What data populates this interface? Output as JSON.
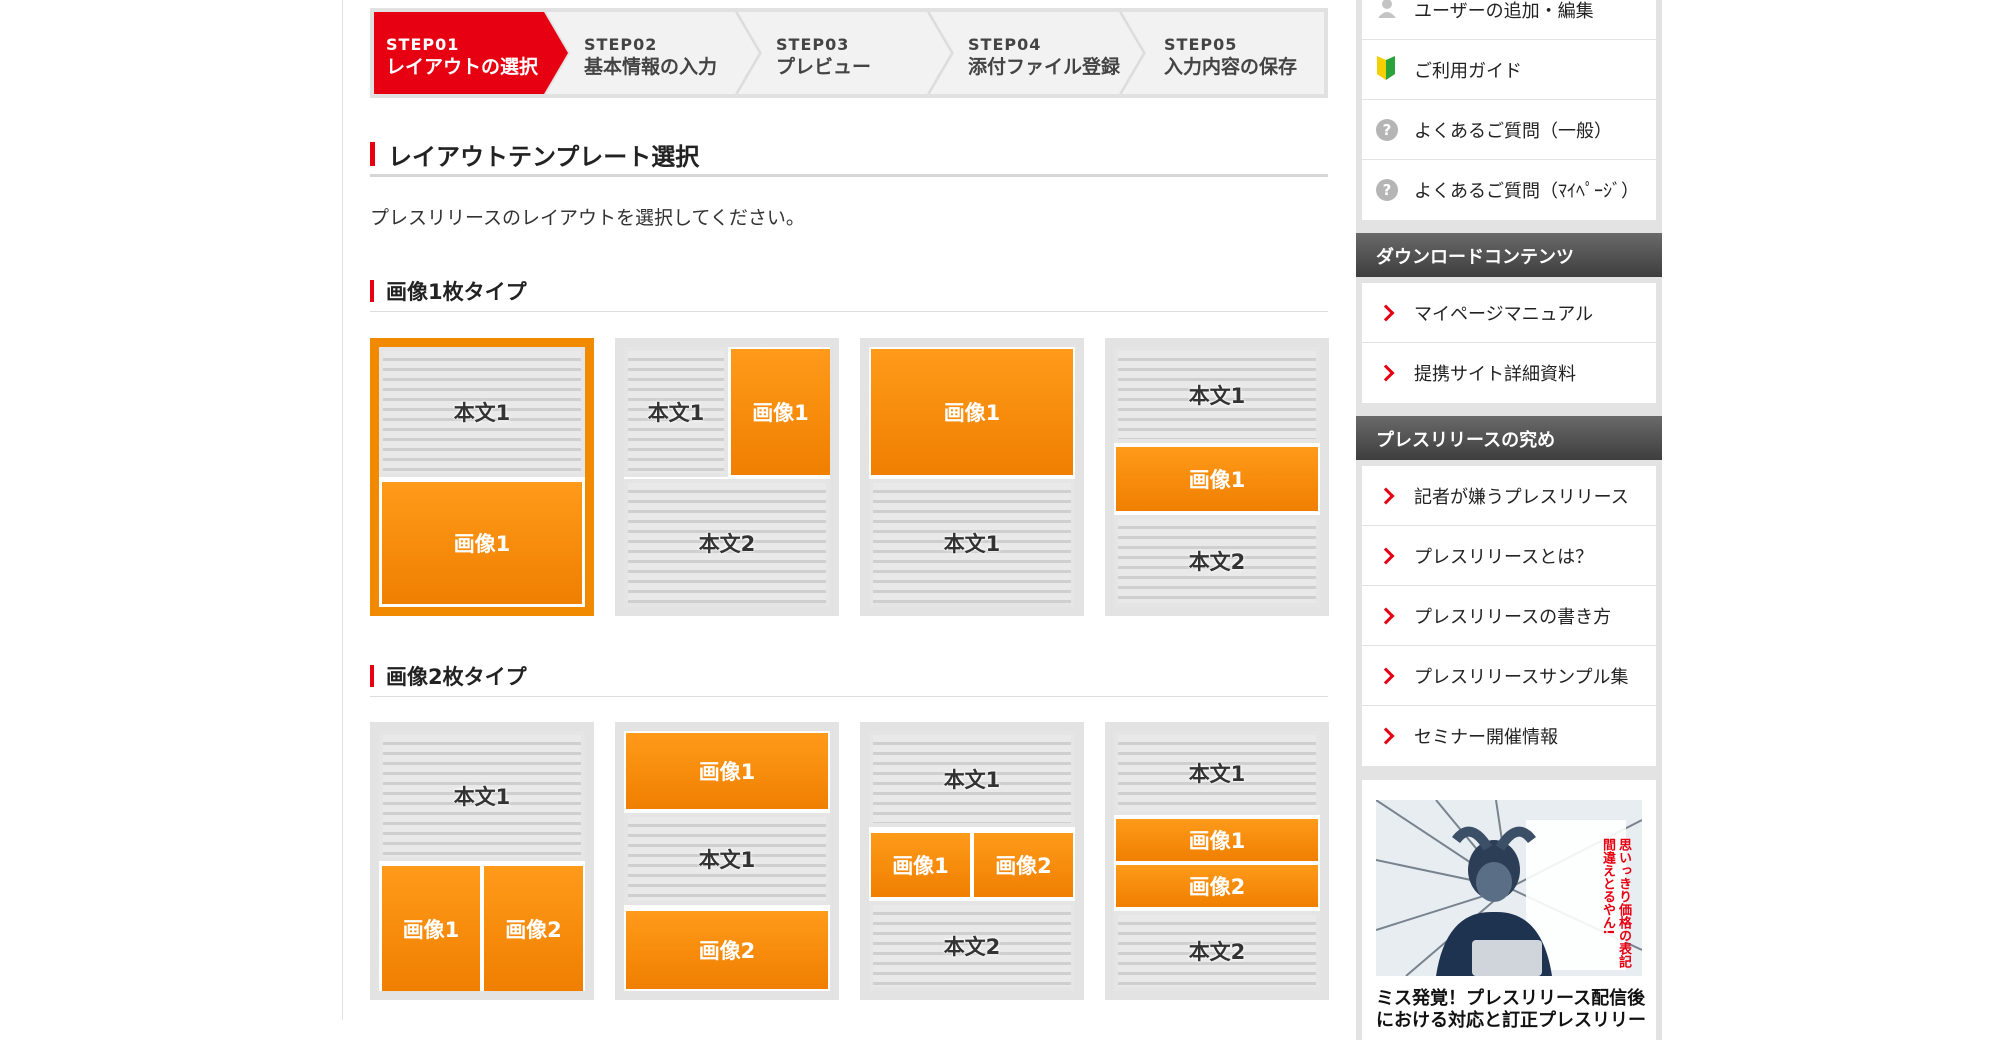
{
  "steps": [
    {
      "num": "STEP01",
      "label": "レイアウトの選択",
      "active": true
    },
    {
      "num": "STEP02",
      "label": "基本情報の入力",
      "active": false
    },
    {
      "num": "STEP03",
      "label": "プレビュー",
      "active": false
    },
    {
      "num": "STEP04",
      "label": "添付ファイル登録",
      "active": false
    },
    {
      "num": "STEP05",
      "label": "入力内容の保存",
      "active": false
    }
  ],
  "main": {
    "heading": "レイアウトテンプレート選択",
    "intro": "プレスリリースのレイアウトを選択してください。",
    "section1": {
      "heading": "画像1枚タイプ",
      "labels": {
        "text1": "本文1",
        "text2": "本文2",
        "img1": "画像1",
        "img2": "画像2"
      }
    },
    "section2": {
      "heading": "画像2枚タイプ",
      "labels": {
        "text1": "本文1",
        "text2": "本文2",
        "img1": "画像1",
        "img2": "画像2"
      }
    },
    "selected_layout": "画像1枚タイプ 1"
  },
  "sidebar": {
    "menu1": [
      {
        "label": "ユーザーの追加・編集",
        "icon": "user-icon"
      },
      {
        "label": "ご利用ガイド",
        "icon": "beginner-leaf-icon"
      },
      {
        "label": "よくあるご質問（一般）",
        "icon": "question-icon"
      },
      {
        "label": "よくあるご質問（ﾏｲﾍﾟｰｼﾞ）",
        "icon": "question-icon"
      }
    ],
    "download_heading": "ダウンロードコンテンツ",
    "download_items": [
      "マイページマニュアル",
      "提携サイト詳細資料"
    ],
    "press_heading": "プレスリリースの究め",
    "press_items": [
      "記者が嫌うプレスリリース",
      "プレスリリースとは？",
      "プレスリリースの書き方",
      "プレスリリースサンプル集",
      "セミナー開催情報"
    ],
    "banner": {
      "callout": "思いっきり価格の表記間違えとるやん!",
      "caption": "ミス発覚！プレスリリース配信後における対応と訂正プレスリリー"
    }
  },
  "colors": {
    "accent_red": "#e60012",
    "orange": "#f28a00",
    "step_gray": "#f2f2f2"
  }
}
